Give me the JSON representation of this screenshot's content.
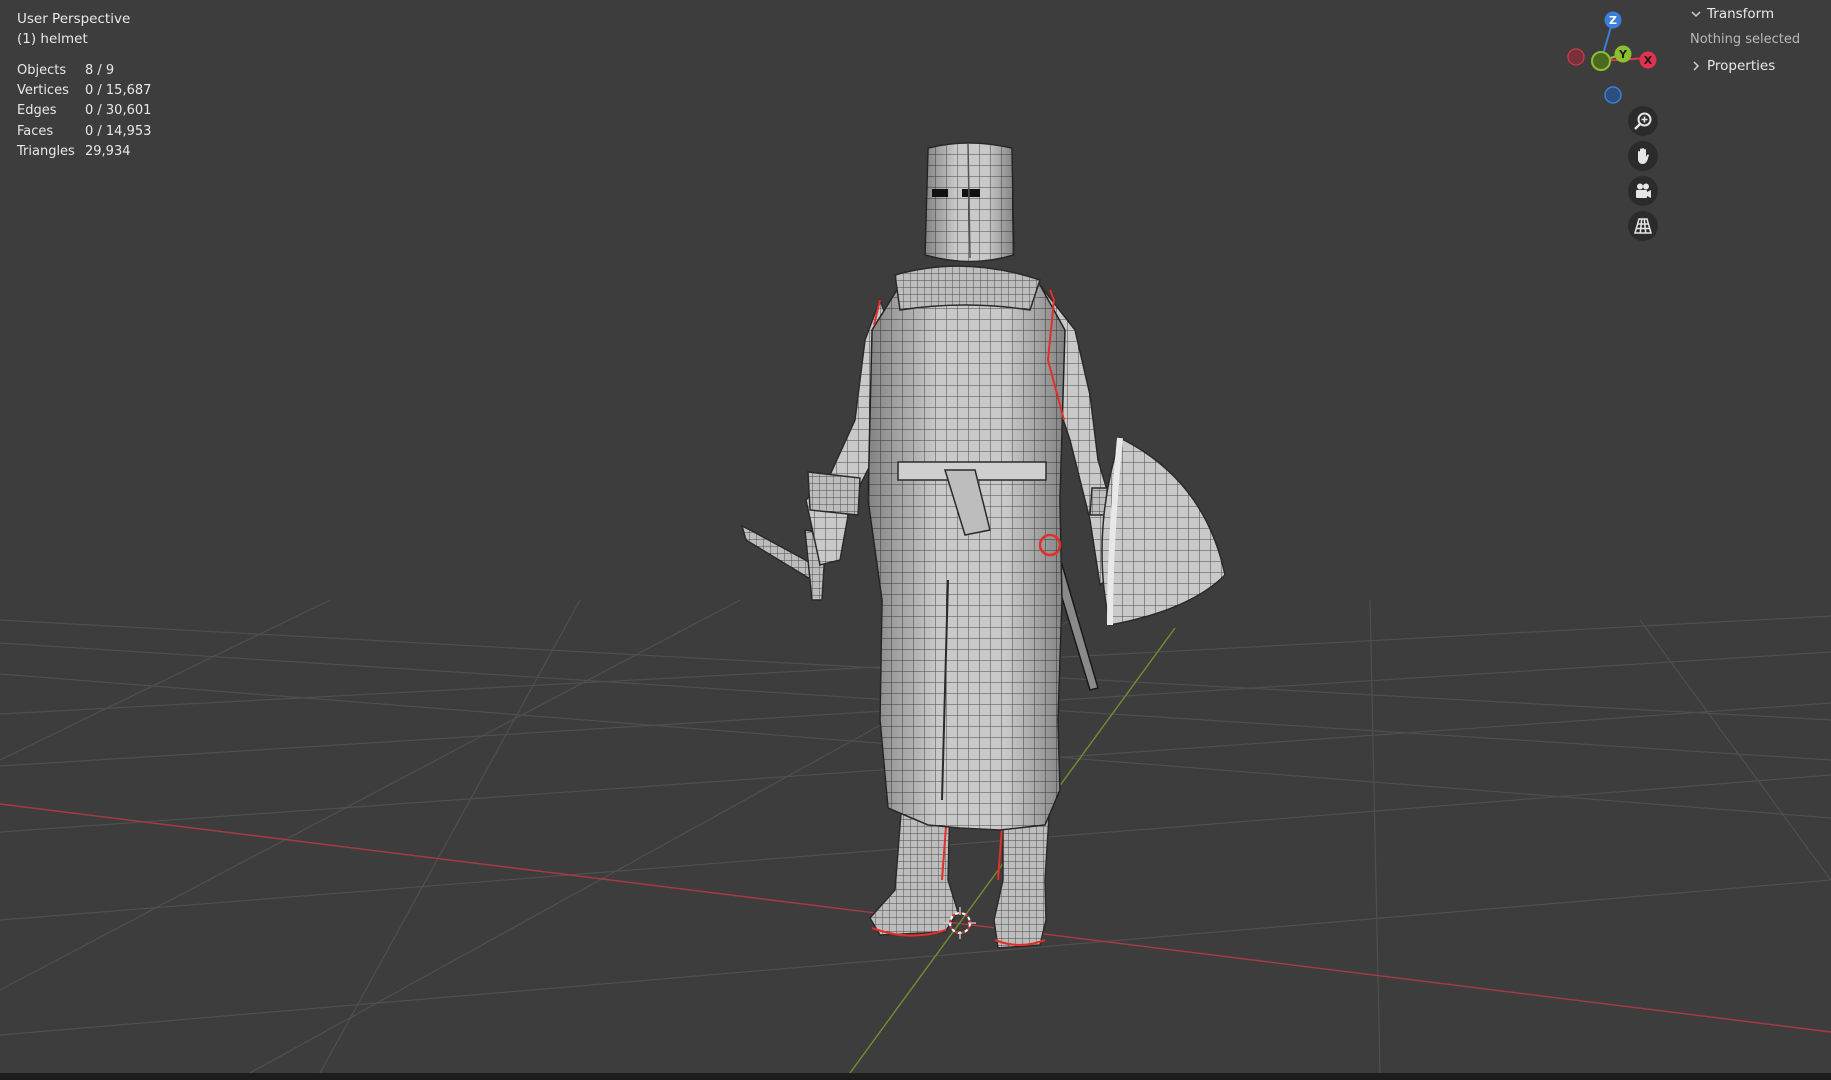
{
  "viewport": {
    "view_name": "User Perspective",
    "active_object": "(1) helmet",
    "stats": [
      {
        "label": "Objects",
        "value": "8 / 9"
      },
      {
        "label": "Vertices",
        "value": "0 / 15,687"
      },
      {
        "label": "Edges",
        "value": "0 / 30,601"
      },
      {
        "label": "Faces",
        "value": "0 / 14,953"
      },
      {
        "label": "Triangles",
        "value": "29,934"
      }
    ]
  },
  "gizmo": {
    "z_label": "Z",
    "y_label": "Y",
    "x_label": "X",
    "colors": {
      "x": "#e0334f",
      "y": "#8cbf2f",
      "z": "#3b7fd9"
    }
  },
  "navigation": {
    "buttons": [
      "zoom-icon",
      "hand-pan-icon",
      "camera-icon",
      "grid-perspective-icon"
    ]
  },
  "sidebar": {
    "transform_label": "Transform",
    "nothing_selected": "Nothing selected",
    "properties_label": "Properties"
  }
}
